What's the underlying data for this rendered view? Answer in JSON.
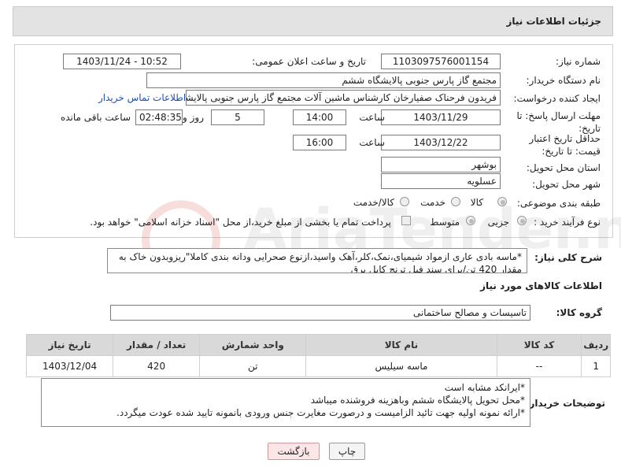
{
  "header": {
    "title": "جزئیات اطلاعات نیاز"
  },
  "form": {
    "need_number_label": "شماره نیاز:",
    "need_number": "1103097576001154",
    "announce_label": "تاریخ و ساعت اعلان عمومی:",
    "announce_value": "1403/11/24 - 10:52",
    "buyer_label": "نام دستگاه خریدار:",
    "buyer_value": "مجتمع گاز پارس جنوبی  پالایشگاه ششم",
    "creator_label": "ایجاد کننده درخواست:",
    "creator_value": "فریدون فرحناک صفیارخان کارشناس ماشین آلات مجتمع گاز پارس جنوبی  پالایشگاه ششم",
    "contact_link": "اطلاعات تماس خریدار",
    "deadline_label": "مهلت ارسال پاسخ: تا تاریخ:",
    "deadline_date": "1403/11/29",
    "time_label": "ساعت",
    "deadline_time": "14:00",
    "days_value": "5",
    "days_label": "روز و",
    "remaining_time": "02:48:35",
    "remaining_label": "ساعت باقی مانده",
    "validity_label": "حداقل تاریخ اعتبار قیمت: تا تاریخ:",
    "validity_date": "1403/12/22",
    "validity_time": "16:00",
    "province_label": "استان محل تحویل:",
    "province_value": "بوشهر",
    "city_label": "شهر محل تحویل:",
    "city_value": "عسلویه",
    "category_label": "طبقه بندی موضوعی:",
    "category_options": [
      "کالا",
      "خدمت",
      "کالا/خدمت"
    ],
    "process_label": "نوع فرآیند خرید :",
    "process_options": [
      "جزیی",
      "متوسط"
    ],
    "payment_note": "پرداخت تمام یا بخشی از مبلغ خرید،از محل \"اسناد خزانه اسلامی\" خواهد بود."
  },
  "description": {
    "label": "شرح کلی نیاز:",
    "text": "*ماسه بادی عاری ازمواد شیمیای،نمک،کلر،آهک واسید،ازنوع صحرایی ودانه بندی کاملا\"ریزوبدون خاک به مقدار 420 تن/برای سند فیل ترنچ کابل برق"
  },
  "goods_section": {
    "title": "اطلاعات کالاهای مورد نیاز",
    "group_label": "گروه کالا:",
    "group_value": "تاسیسات و مصالح ساختمانی"
  },
  "table": {
    "headers": [
      "ردیف",
      "کد کالا",
      "نام کالا",
      "واحد شمارش",
      "تعداد / مقدار",
      "تاریخ نیاز"
    ],
    "rows": [
      [
        "1",
        "--",
        "ماسه سیلیس",
        "تن",
        "420",
        "1403/12/04"
      ]
    ]
  },
  "buyer_notes": {
    "label": "توضیحات خریدار:",
    "lines": [
      "*ایرانکد مشابه است",
      "*محل تحویل پالایشگاه ششم وباهزینه فروشنده میباشد",
      "*ارائه نمونه اولیه جهت تائید الزامیست و درصورت مغایرت جنس ورودی بانمونه تایید شده عودت میگردد."
    ]
  },
  "buttons": {
    "print": "چاپ",
    "back": "بازگشت"
  },
  "watermark_text": "AriaTender.net"
}
